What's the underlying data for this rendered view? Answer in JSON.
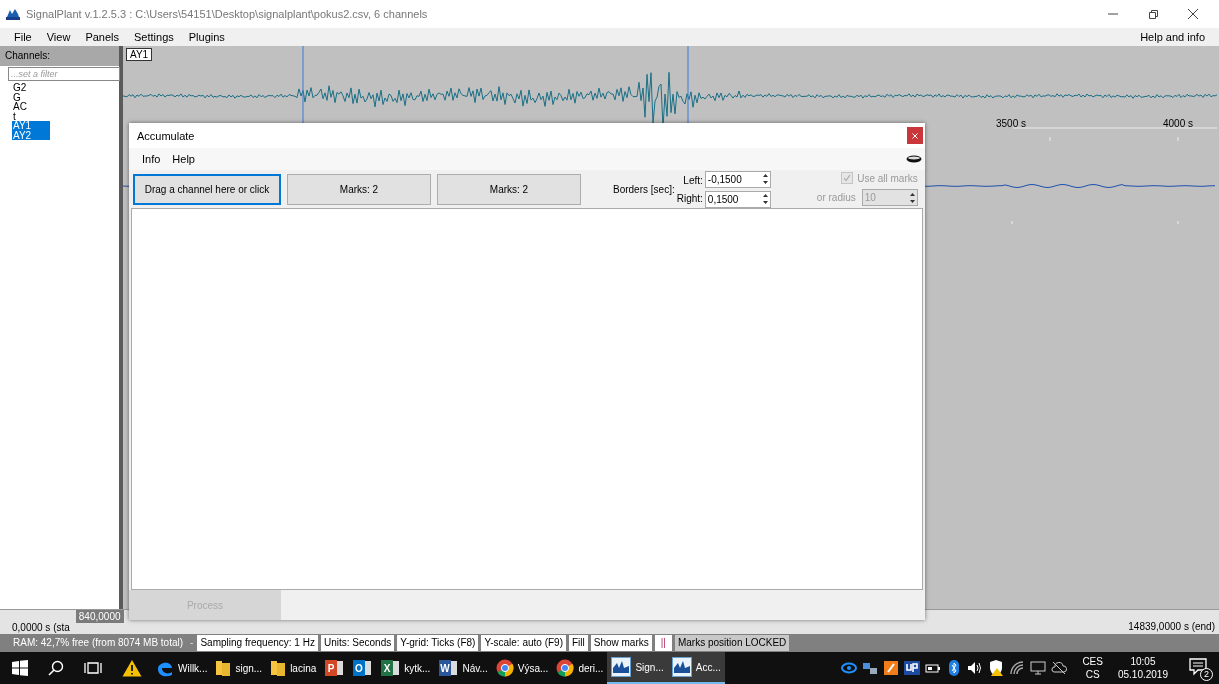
{
  "window": {
    "title": "SignalPlant v.1.2.5.3 : C:\\Users\\54151\\Desktop\\signalplant\\pokus2.csv, 6 channels"
  },
  "menu": {
    "items": [
      "File",
      "View",
      "Panels",
      "Settings",
      "Plugins"
    ],
    "help": "Help and info"
  },
  "channels": {
    "header": "Channels:",
    "filter_placeholder": "...set a filter",
    "items": [
      {
        "label": "G2",
        "selected": false
      },
      {
        "label": "G",
        "selected": false
      },
      {
        "label": "AC",
        "selected": false
      },
      {
        "label": "t",
        "selected": false
      },
      {
        "label": "AY1",
        "selected": true
      },
      {
        "label": "AY2",
        "selected": true
      }
    ]
  },
  "plot": {
    "channel_label": "AY1",
    "axis_labels": [
      "3500 s",
      "4000 s"
    ]
  },
  "dialog": {
    "title": "Accumulate",
    "menu": [
      "Info",
      "Help"
    ],
    "buttons": [
      {
        "label": "Drag a channel here or click",
        "focused": true
      },
      {
        "label": "Marks: 2",
        "focused": false
      },
      {
        "label": "Marks: 2",
        "focused": false
      }
    ],
    "borders_label": "Borders [sec]:",
    "left": {
      "label": "Left:",
      "value": "-0,1500"
    },
    "right": {
      "label": "Right:",
      "value": "0,1500"
    },
    "use_all_marks": {
      "label": "Use all marks",
      "checked": true,
      "disabled": true
    },
    "radius": {
      "label": "or radius",
      "value": "10",
      "disabled": true
    },
    "process": {
      "label": "Process",
      "disabled": true
    }
  },
  "timeline": {
    "start": "0,0000 s (sta",
    "cursor": "840,0000",
    "end": "14839,0000 s (end)"
  },
  "status_bar": [
    {
      "kind": "info",
      "text": "RAM: 42,7% free (from 8074 MB total)"
    },
    {
      "kind": "separator",
      "text": "-"
    },
    {
      "kind": "toggle",
      "text": "Sampling frequency: 1 Hz"
    },
    {
      "kind": "toggle",
      "text": "Units: Seconds"
    },
    {
      "kind": "toggle",
      "text": "Y-grid:  Ticks (F8)"
    },
    {
      "kind": "toggle",
      "text": "Y-scale: auto (F9)"
    },
    {
      "kind": "toggle",
      "text": "Fill"
    },
    {
      "kind": "toggle",
      "text": "Show marks"
    },
    {
      "kind": "marker",
      "text": "||"
    },
    {
      "kind": "info",
      "text": "Marks position LOCKED"
    }
  ],
  "taskbar": {
    "apps": [
      {
        "kind": "edge",
        "label": "Willk...",
        "active": false
      },
      {
        "kind": "folder",
        "label": "sign...",
        "active": false
      },
      {
        "kind": "folder",
        "label": "lacina",
        "active": false
      },
      {
        "kind": "slides",
        "letter": "P",
        "active": false
      },
      {
        "kind": "mail",
        "letter": "O",
        "active": false
      },
      {
        "kind": "sheet",
        "letter": "X",
        "label": "kytk...",
        "active": false
      },
      {
        "kind": "doc",
        "letter": "W",
        "label": "Náv...",
        "active": false
      },
      {
        "kind": "browser",
        "label": "Výsa...",
        "active": false
      },
      {
        "kind": "browser",
        "label": "deri...",
        "active": false
      },
      {
        "kind": "signal",
        "label": "Sign...",
        "active": true
      },
      {
        "kind": "signal",
        "label": "Acc...",
        "active": true
      }
    ],
    "language": [
      "CES",
      "CS"
    ],
    "time": "10:05",
    "date": "05.10.2019",
    "notifications": "2"
  }
}
